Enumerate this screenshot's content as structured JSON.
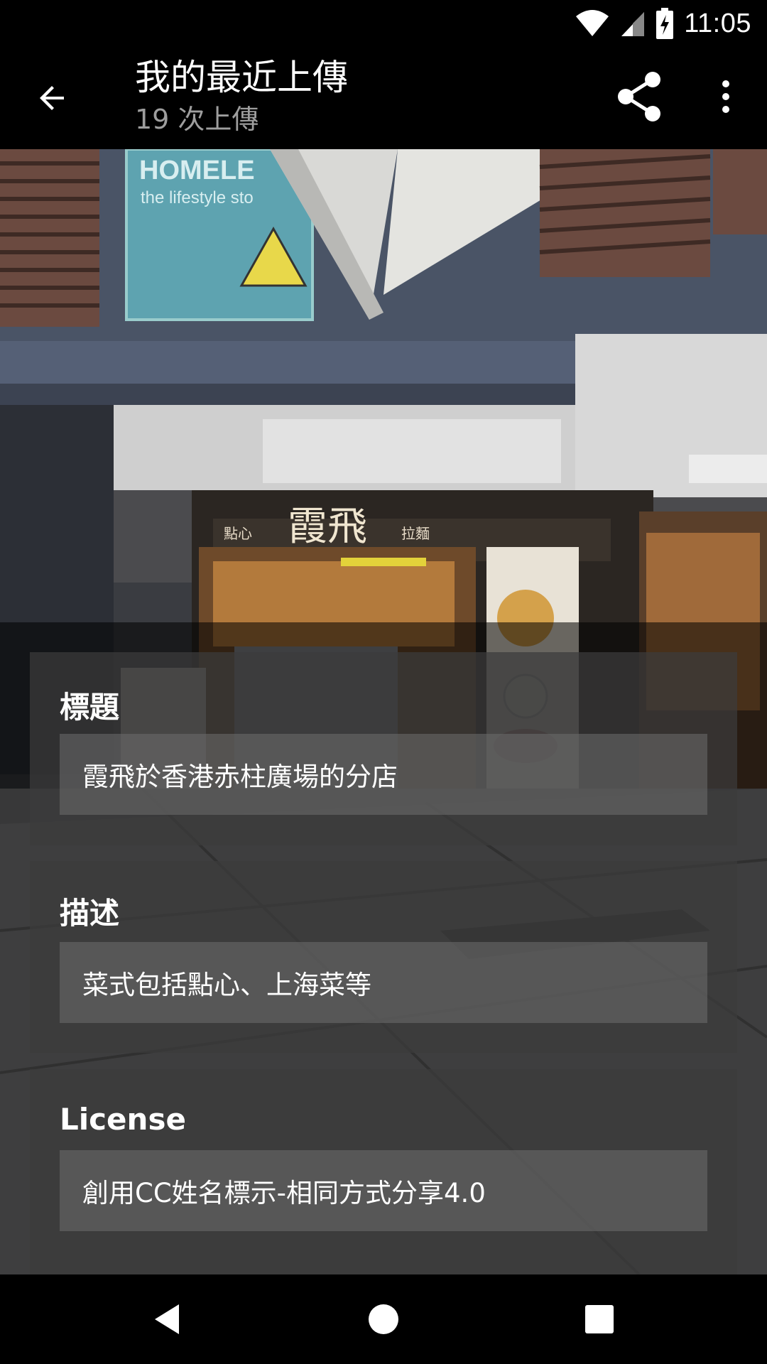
{
  "status_bar": {
    "time": "11:05",
    "icons": [
      "wifi-icon",
      "cell-signal-icon",
      "battery-charging-icon"
    ]
  },
  "app_bar": {
    "title": "我的最近上傳",
    "subtitle": "19 次上傳",
    "icons": {
      "back": "arrow-left-icon",
      "share": "share-icon",
      "more": "more-vert-icon"
    }
  },
  "details": {
    "title_section": {
      "label": "標題",
      "value": "霞飛於香港赤柱廣場的分店"
    },
    "description_section": {
      "label": "描述",
      "value": "菜式包括點心、上海菜等"
    },
    "license_section": {
      "label": "License",
      "value": "創用CC姓名標示-相同方式分享4.0"
    }
  },
  "photo_signage": {
    "shop_name": "霞飛",
    "left_sign": "點心",
    "right_sign": "拉麵",
    "store_banner": "HOMELE",
    "store_banner_sub": "the lifestyle sto"
  },
  "nav_bar": {
    "icons": [
      "back-triangle-icon",
      "home-circle-icon",
      "recents-square-icon"
    ]
  }
}
